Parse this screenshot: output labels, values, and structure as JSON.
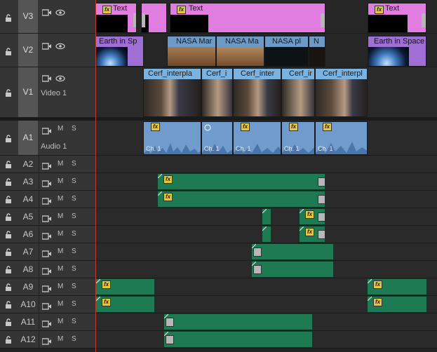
{
  "tracks": {
    "v3": {
      "name": "V3"
    },
    "v2": {
      "name": "V2"
    },
    "v1": {
      "name": "V1",
      "label": "Video 1"
    },
    "a1": {
      "name": "A1",
      "label": "Audio 1"
    },
    "a2": {
      "name": "A2"
    },
    "a3": {
      "name": "A3"
    },
    "a4": {
      "name": "A4"
    },
    "a5": {
      "name": "A5"
    },
    "a6": {
      "name": "A6"
    },
    "a7": {
      "name": "A7"
    },
    "a8": {
      "name": "A8"
    },
    "a9": {
      "name": "A9"
    },
    "a10": {
      "name": "A10"
    },
    "a11": {
      "name": "A11"
    },
    "a12": {
      "name": "A12"
    }
  },
  "buttons": {
    "mute": "M",
    "solo": "S",
    "fx": "fx"
  },
  "clips": {
    "v3_text1": "Text",
    "v3_text2": "Text",
    "v3_text3": "Text",
    "v2_earth1": "Earth in Sp",
    "v2_nasa1": "NASA Mar",
    "v2_nasa2": "NASA Ma",
    "v2_nasa3": "NASA pl",
    "v2_nasa4": "N",
    "v2_earth2": "Earth in Space",
    "v1_c1": "Cerf_interpla",
    "v1_c2": "Cerf_i",
    "v1_c3": "Cerf_inter",
    "v1_c4": "Cerf_ir",
    "v1_c5": "Cerf_interpl",
    "a1_ch": "Ch. 1"
  },
  "colors": {
    "video_title": "#e17ce1",
    "video_footage": "#7ab2e0",
    "audio_clip": "#1d7a52",
    "playhead": "#c0392b"
  }
}
